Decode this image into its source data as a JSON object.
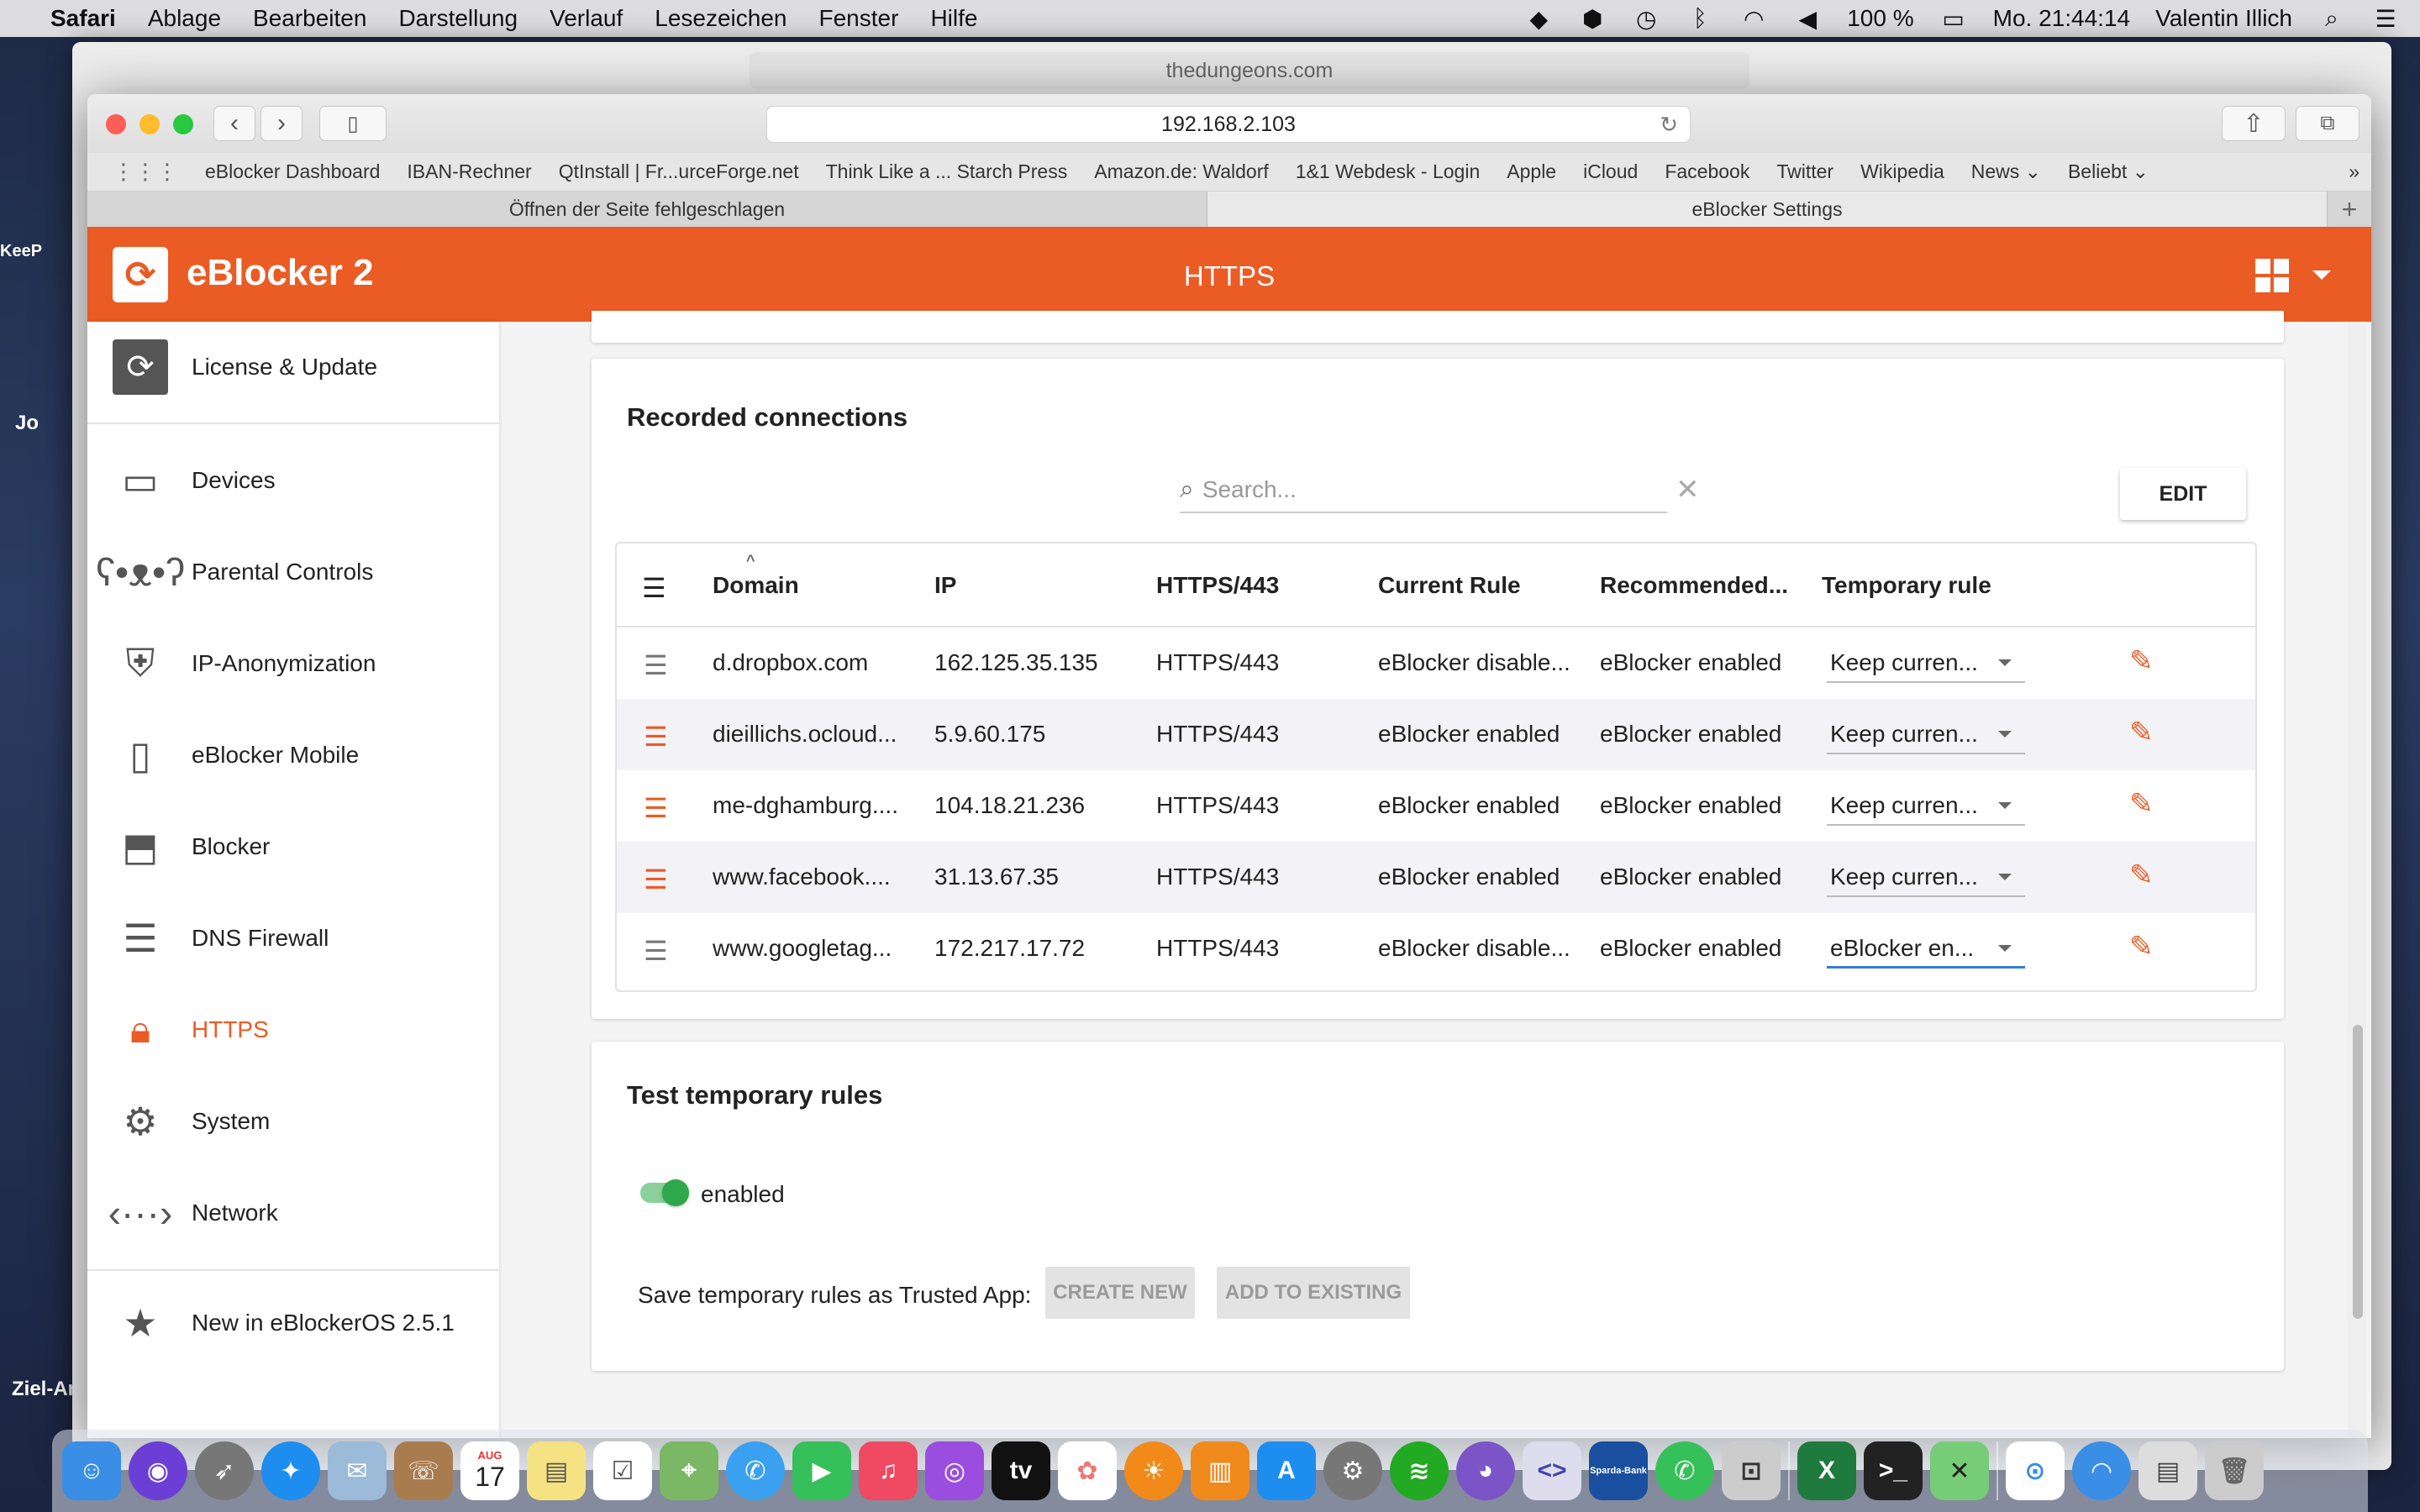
{
  "menubar": {
    "app": "Safari",
    "items": [
      "Ablage",
      "Bearbeiten",
      "Darstellung",
      "Verlauf",
      "Lesezeichen",
      "Fenster",
      "Hilfe"
    ],
    "battery": "100 %",
    "clock": "Mo. 21:44:14",
    "user": "Valentin Illich"
  },
  "desktop": {
    "label_ziel": "Ziel-Ar",
    "label_kee": "KeeP",
    "label_jo": "Jo"
  },
  "background_window": {
    "url": "thedungeons.com"
  },
  "browser": {
    "url": "192.168.2.103",
    "bookmarks": [
      "eBlocker Dashboard",
      "IBAN-Rechner",
      "QtInstall | Fr...urceForge.net",
      "Think Like a ... Starch Press",
      "Amazon.de: Waldorf",
      "1&1 Webdesk - Login",
      "Apple",
      "iCloud",
      "Facebook",
      "Twitter",
      "Wikipedia",
      "News",
      "Beliebt"
    ],
    "tabs": [
      "Öffnen der Seite fehlgeschlagen",
      "eBlocker Settings"
    ]
  },
  "app": {
    "logo": "eBlocker 2",
    "title": "HTTPS"
  },
  "sidebar": {
    "items": [
      {
        "label": "License & Update",
        "icon": "refresh-icon"
      },
      {
        "label": "Devices",
        "icon": "devices-icon"
      },
      {
        "label": "Parental Controls",
        "icon": "teddy-bear-icon"
      },
      {
        "label": "IP-Anonymization",
        "icon": "shield-icon"
      },
      {
        "label": "eBlocker Mobile",
        "icon": "phone-icon"
      },
      {
        "label": "Blocker",
        "icon": "blocker-icon"
      },
      {
        "label": "DNS Firewall",
        "icon": "server-icon"
      },
      {
        "label": "HTTPS",
        "icon": "lock-icon"
      },
      {
        "label": "System",
        "icon": "gear-icon"
      },
      {
        "label": "Network",
        "icon": "network-icon"
      },
      {
        "label": "New in eBlockerOS 2.5.1",
        "icon": "star-icon"
      }
    ]
  },
  "recorded": {
    "title": "Recorded connections",
    "search_placeholder": "Search...",
    "edit_label": "EDIT",
    "columns": [
      "Domain",
      "IP",
      "HTTPS/443",
      "Current Rule",
      "Recommended...",
      "Temporary rule"
    ],
    "rows": [
      {
        "domain": "d.dropbox.com",
        "ip": "162.125.35.135",
        "port": "HTTPS/443",
        "current": "eBlocker disable...",
        "recommended": "eBlocker enabled",
        "temporary": "Keep curren...",
        "highlight": false
      },
      {
        "domain": "dieillichs.ocloud...",
        "ip": "5.9.60.175",
        "port": "HTTPS/443",
        "current": "eBlocker enabled",
        "recommended": "eBlocker enabled",
        "temporary": "Keep curren...",
        "highlight": true
      },
      {
        "domain": "me-dghamburg....",
        "ip": "104.18.21.236",
        "port": "HTTPS/443",
        "current": "eBlocker enabled",
        "recommended": "eBlocker enabled",
        "temporary": "Keep curren...",
        "highlight": true
      },
      {
        "domain": "www.facebook....",
        "ip": "31.13.67.35",
        "port": "HTTPS/443",
        "current": "eBlocker enabled",
        "recommended": "eBlocker enabled",
        "temporary": "Keep curren...",
        "highlight": true
      },
      {
        "domain": "www.googletag...",
        "ip": "172.217.17.72",
        "port": "HTTPS/443",
        "current": "eBlocker disable...",
        "recommended": "eBlocker enabled",
        "temporary": "eBlocker en...",
        "highlight": false
      }
    ]
  },
  "temporary": {
    "title": "Test temporary rules",
    "toggle_label": "enabled",
    "save_label": "Save temporary rules as Trusted App:",
    "create_new": "CREATE NEW",
    "add_existing": "ADD TO EXISTING"
  },
  "colors": {
    "accent": "#eb5b24",
    "toggle_on": "#2ea84a"
  },
  "dock": {
    "calendar_month": "AUG",
    "calendar_day": "17",
    "bank_label": "Sparda-Bank"
  }
}
